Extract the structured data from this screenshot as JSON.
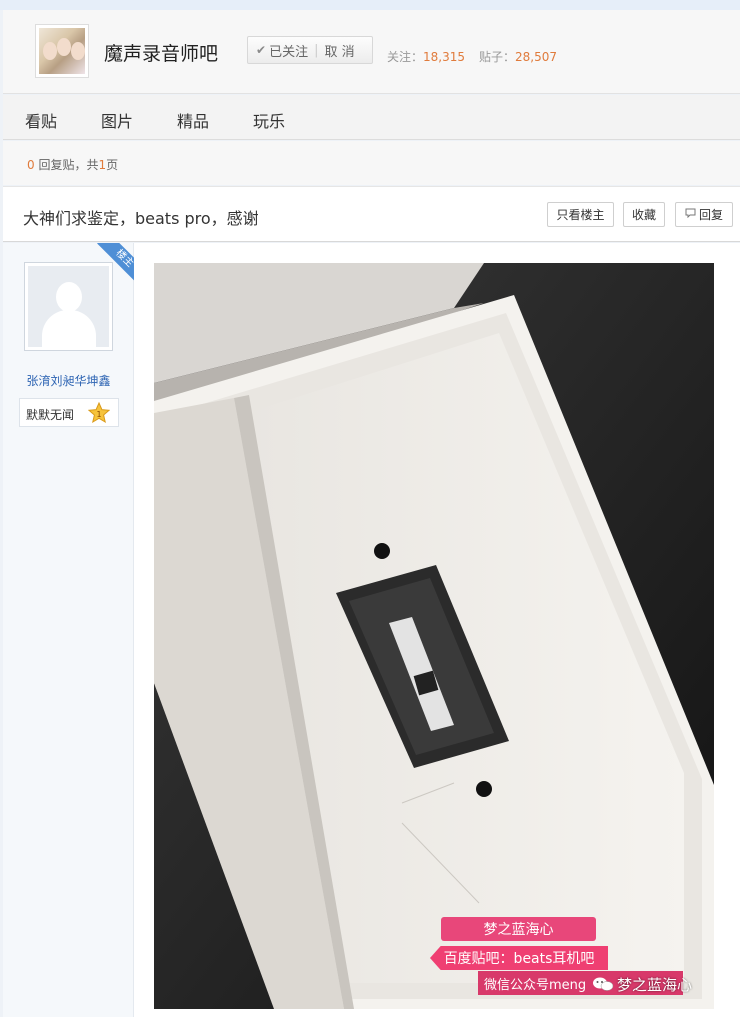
{
  "forum": {
    "name": "魔声录音师吧",
    "follow_label": "已关注",
    "cancel_label": "取 消",
    "followers_label": "关注：",
    "followers_count": "18,315",
    "posts_label": "贴子：",
    "posts_count": "28,507"
  },
  "tabs": [
    {
      "label": "看贴"
    },
    {
      "label": "图片"
    },
    {
      "label": "精品"
    },
    {
      "label": "玩乐"
    }
  ],
  "reply_info": {
    "count": "0",
    "count_label": "回复贴，共",
    "pages": "1",
    "pages_label": "页"
  },
  "post": {
    "title": "大神们求鉴定，beats pro，感谢",
    "only_op_label": "只看楼主",
    "favorite_label": "收藏",
    "reply_label": "回复"
  },
  "author": {
    "ribbon_label": "楼主",
    "name": "张淯刘昶华坤鑫",
    "level_title": "默默无闻",
    "level_number": "1"
  },
  "watermark": {
    "line1": "梦之蓝海心",
    "line2": "百度贴吧：beats耳机吧",
    "line3": "微信公众号meng",
    "brand": "梦之蓝海心"
  },
  "colors": {
    "accent_orange": "#e07b3c",
    "link_blue": "#2d64b3",
    "ribbon_blue": "#4f8fd6",
    "watermark_pink": "#e8477a"
  },
  "icons": {
    "follow": "check-icon",
    "reply": "comment-icon",
    "level": "star-badge-icon",
    "watermark": "wechat-icon"
  }
}
